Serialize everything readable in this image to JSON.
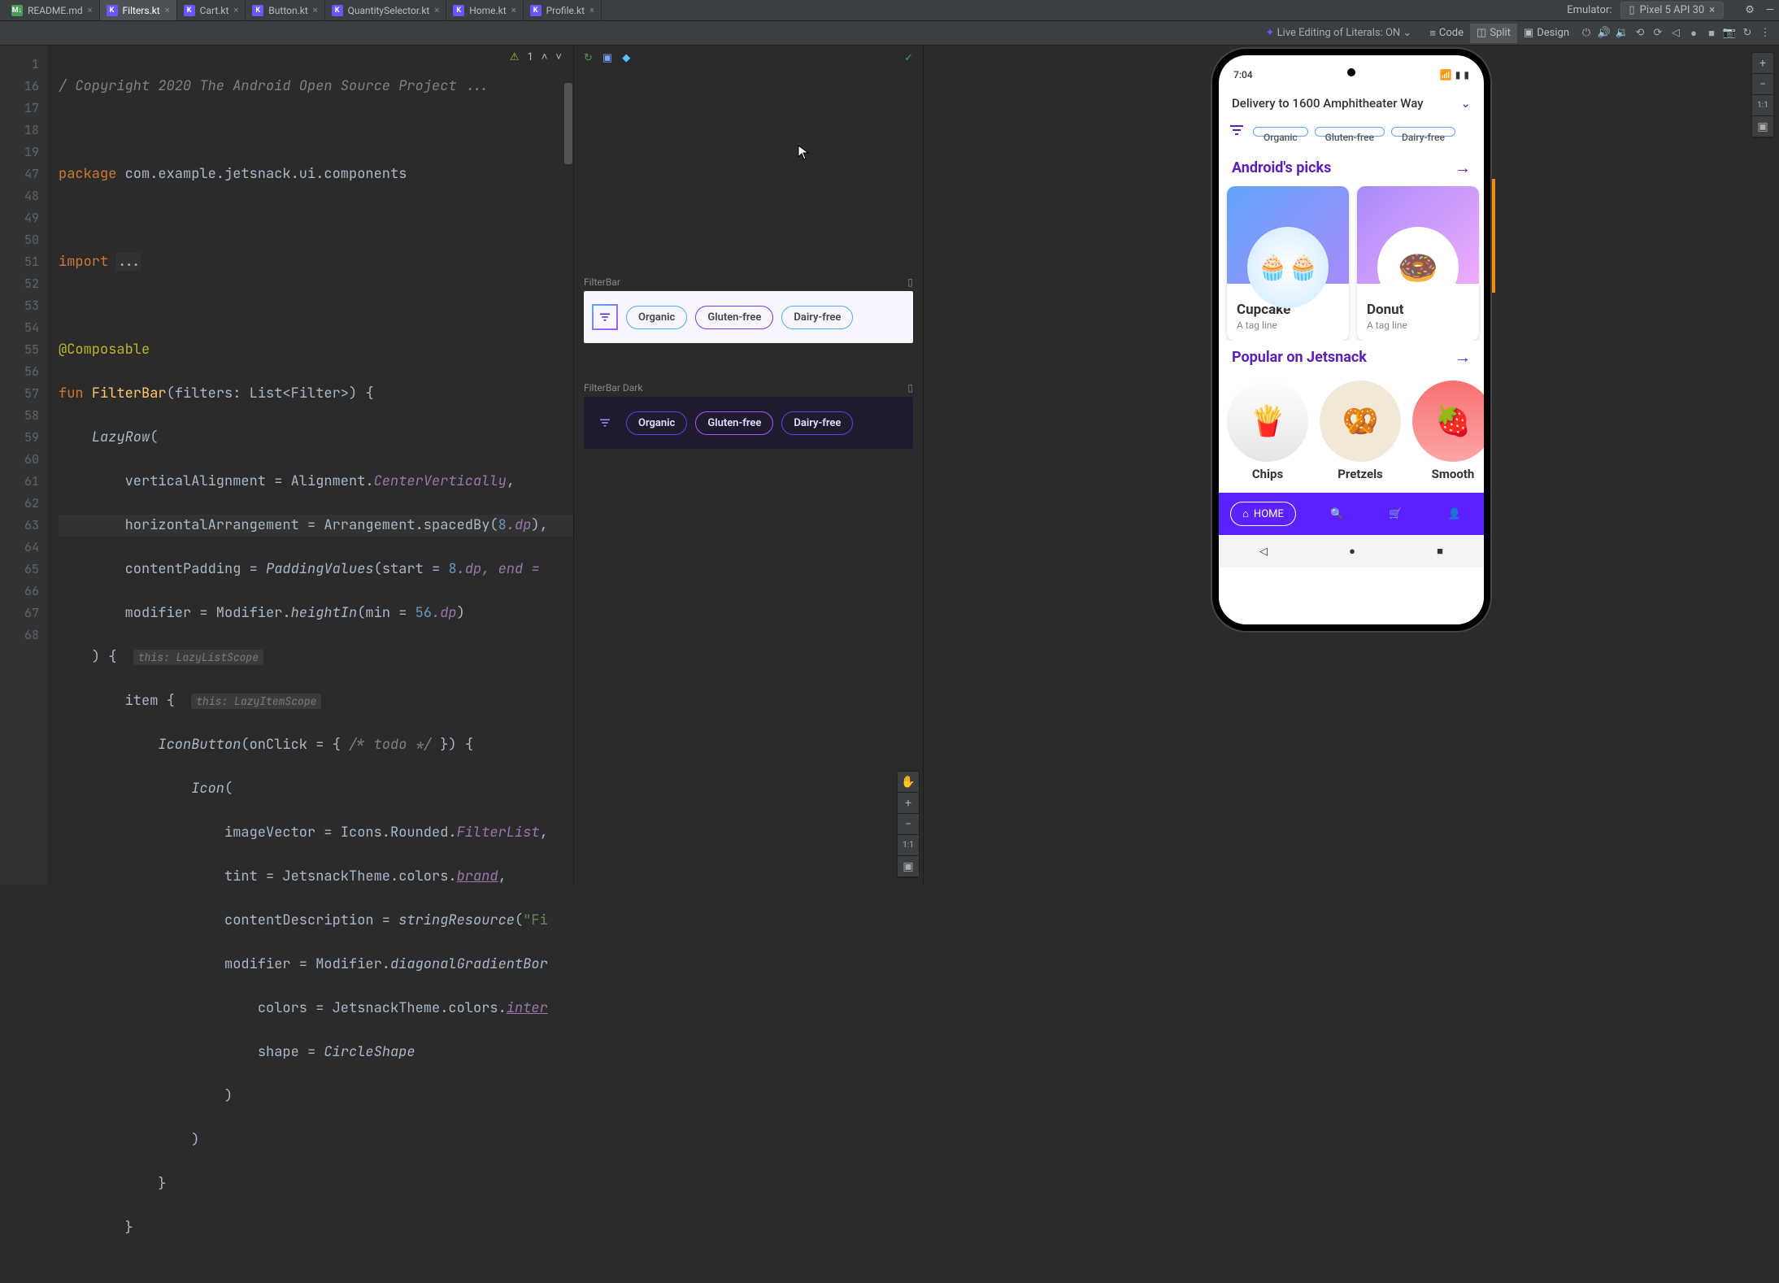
{
  "tabs": [
    {
      "name": "README.md",
      "type": "md"
    },
    {
      "name": "Filters.kt",
      "type": "kt",
      "active": true
    },
    {
      "name": "Cart.kt",
      "type": "kt"
    },
    {
      "name": "Button.kt",
      "type": "kt"
    },
    {
      "name": "QuantitySelector.kt",
      "type": "kt"
    },
    {
      "name": "Home.kt",
      "type": "kt"
    },
    {
      "name": "Profile.kt",
      "type": "kt"
    }
  ],
  "emulator": {
    "label": "Emulator:",
    "device": "Pixel 5 API 30"
  },
  "toolbar": {
    "live_edit": "Live Editing of Literals: ON",
    "code": "Code",
    "split": "Split",
    "design": "Design"
  },
  "code": {
    "lines": [
      "1",
      "16",
      "17",
      "18",
      "19",
      "47",
      "48",
      "49",
      "50",
      "51",
      "52",
      "53",
      "54",
      "55",
      "56",
      "57",
      "58",
      "59",
      "60",
      "61",
      "62",
      "63",
      "64",
      "65",
      "66",
      "67",
      "68"
    ],
    "warn": "1",
    "hint_lazylist": "this: LazyListScope",
    "hint_lazyitem": "this: LazyItemScope",
    "l1_c": "/ Copyright 2020 The Android Open Source Project ...",
    "l3_pkg": "package",
    "l3_v": " com.example.jetsnack.ui.components",
    "l5_imp": "import ",
    "l5_d": "...",
    "l7": "@Composable",
    "l8_a": "fun ",
    "l8_b": "FilterBar",
    "l8_c": "(filters: List<Filter>) {",
    "l9": "LazyRow",
    "l9b": "(",
    "l10_a": "verticalAlignment = Alignment.",
    "l10_b": "CenterVertically",
    "l10_c": ",",
    "l11_a": "horizontalArrangement = Arrangement.spacedBy(",
    "l11_b": "8",
    "l11_c": ".dp",
    "l11_d": "),",
    "l12_a": "contentPadding = ",
    "l12_b": "PaddingValues",
    "l12_c": "(start = ",
    "l12_d": "8",
    "l12_e": ".dp, end = ",
    "l13_a": "modifier = Modifier.",
    "l13_b": "heightIn",
    "l13_c": "(min = ",
    "l13_d": "56",
    "l13_e": ".dp",
    "l13_f": ")",
    "l14": ") {",
    "l15_a": "item ",
    "l15_b": "{",
    "l16_a": "IconButton",
    "l16_b": "(onClick = { ",
    "l16_c": "/* todo */",
    "l16_d": " }) {",
    "l17_a": "Icon",
    "l17_b": "(",
    "l18_a": "imageVector = Icons.Rounded.",
    "l18_b": "FilterList",
    "l18_c": ",",
    "l19_a": "tint = JetsnackTheme.colors.",
    "l19_b": "brand",
    "l19_c": ",",
    "l20_a": "contentDescription = ",
    "l20_b": "stringResource",
    "l20_c": "(",
    "l20_d": "\"Fi",
    "l21_a": "modifier = Modifier.",
    "l21_b": "diagonalGradientBor",
    "l22_a": "colors = JetsnackTheme.colors.",
    "l22_b": "inter",
    "l23_a": "shape = ",
    "l23_b": "CircleShape",
    "l24": ")",
    "l25": ")",
    "l26": "}",
    "l27": "}"
  },
  "preview": {
    "light_label": "FilterBar",
    "dark_label": "FilterBar Dark",
    "chips": [
      "Organic",
      "Gluten-free",
      "Dairy-free"
    ]
  },
  "zoom": {
    "plus": "+",
    "minus": "−",
    "one": "1:1"
  },
  "app": {
    "time": "7:04",
    "delivery": "Delivery to 1600 Amphitheater Way",
    "filters": [
      "Organic",
      "Gluten-free",
      "Dairy-free"
    ],
    "sec1": "Android's picks",
    "sec2": "Popular on Jetsnack",
    "cards": [
      {
        "name": "Cupcake",
        "tag": "A tag line"
      },
      {
        "name": "Donut",
        "tag": "A tag line"
      }
    ],
    "circles": [
      {
        "name": "Chips"
      },
      {
        "name": "Pretzels"
      },
      {
        "name": "Smooth"
      }
    ],
    "home": "HOME"
  }
}
